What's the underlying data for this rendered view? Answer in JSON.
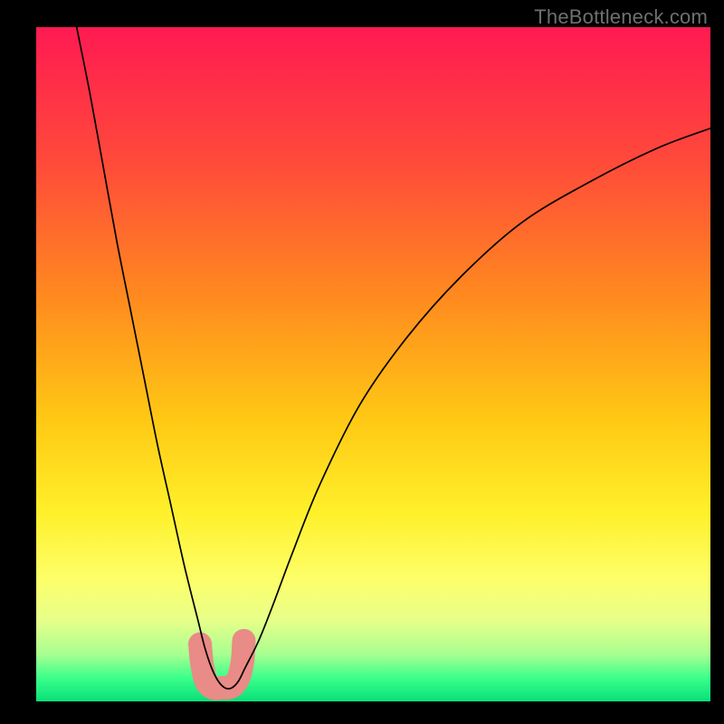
{
  "watermark": "TheBottleneck.com",
  "chart_data": {
    "type": "line",
    "title": "",
    "xlabel": "",
    "ylabel": "",
    "xlim": [
      0,
      100
    ],
    "ylim": [
      0,
      100
    ],
    "grid": false,
    "legend": false,
    "annotations": [],
    "gradient_stops": [
      {
        "offset": 0.0,
        "color": "#ff1a52"
      },
      {
        "offset": 0.2,
        "color": "#ff4a3a"
      },
      {
        "offset": 0.4,
        "color": "#ff8a1f"
      },
      {
        "offset": 0.58,
        "color": "#ffc814"
      },
      {
        "offset": 0.72,
        "color": "#fff02a"
      },
      {
        "offset": 0.82,
        "color": "#fdff6a"
      },
      {
        "offset": 0.88,
        "color": "#e7ff8a"
      },
      {
        "offset": 0.93,
        "color": "#a8ff90"
      },
      {
        "offset": 0.965,
        "color": "#3bff8a"
      },
      {
        "offset": 1.0,
        "color": "#08e07a"
      }
    ],
    "series": [
      {
        "name": "bottleneck-curve",
        "x": [
          6,
          8,
          10,
          12,
          14,
          16,
          18,
          20,
          22,
          24,
          25,
          26,
          27,
          28,
          29,
          30,
          31,
          33,
          35,
          38,
          42,
          48,
          55,
          63,
          72,
          82,
          92,
          100
        ],
        "y": [
          100,
          90,
          79,
          68,
          58,
          48,
          38,
          29,
          20,
          12,
          8,
          5,
          3,
          2,
          2,
          3,
          5,
          9,
          14,
          22,
          32,
          44,
          54,
          63,
          71,
          77,
          82,
          85
        ]
      }
    ],
    "highlight_band": {
      "name": "optimal-range",
      "color": "#e98b86",
      "x": [
        24.3,
        24.6,
        25.2,
        26.2,
        27.5,
        29.0,
        30.0,
        30.6,
        30.8
      ],
      "y": [
        8.5,
        5.5,
        3.0,
        2.0,
        2.0,
        2.2,
        3.5,
        6.0,
        9.0
      ]
    }
  }
}
